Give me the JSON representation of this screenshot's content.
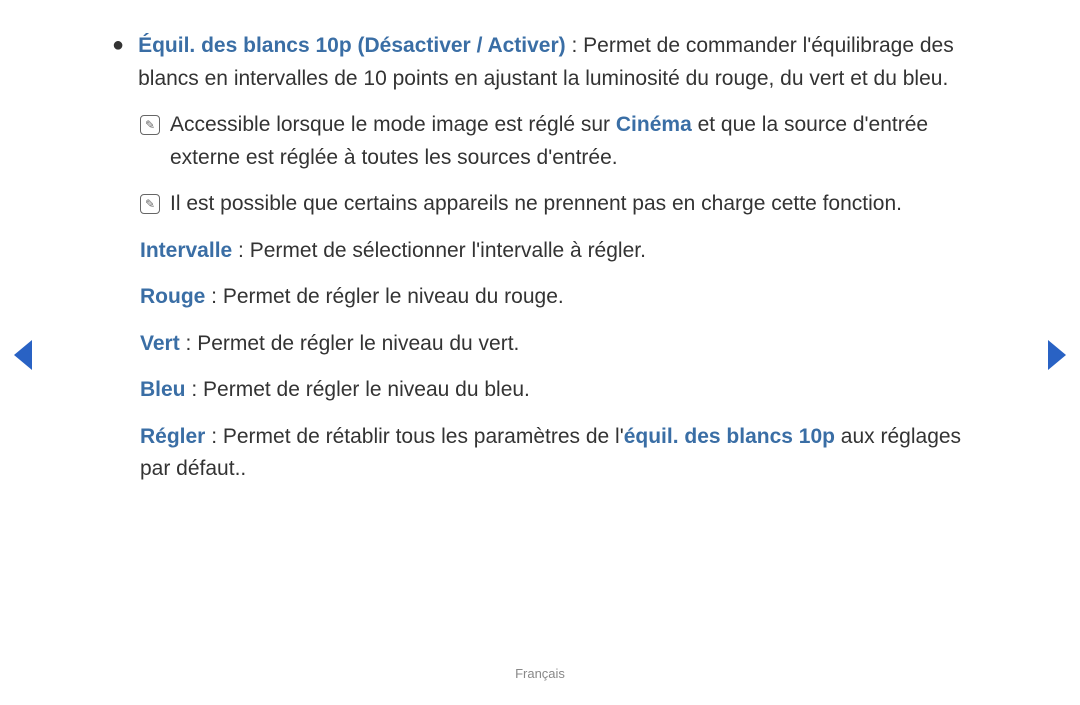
{
  "main": {
    "title": "Équil. des blancs 10p (Désactiver / Activer)",
    "title_after": " : Permet de commander l'équilibrage des blancs en intervalles de 10 points en ajustant la luminosité du rouge, du vert et du bleu.",
    "note1_before": "Accessible lorsque le mode image est réglé sur ",
    "note1_highlight": "Cinéma",
    "note1_after": " et que la source d'entrée externe est réglée à toutes les sources d'entrée.",
    "note2": "Il est possible que certains appareils ne prennent pas en charge cette fonc­tion.",
    "intervalle_label": "Intervalle",
    "intervalle_text": " : Permet de sélectionner l'intervalle à régler.",
    "rouge_label": "Rouge",
    "rouge_text": " : Permet de régler le niveau du rouge.",
    "vert_label": "Vert",
    "vert_text": " : Permet de régler le niveau du vert.",
    "bleu_label": "Bleu",
    "bleu_text": " : Permet de régler le niveau du bleu.",
    "regler_label": "Régler",
    "regler_before": " : Permet de rétablir tous les paramètres de l'",
    "regler_highlight": "équil. des blancs 10p",
    "regler_after": " aux réglages par défaut..",
    "note_icon": "✎"
  },
  "footer": {
    "language": "Français"
  }
}
